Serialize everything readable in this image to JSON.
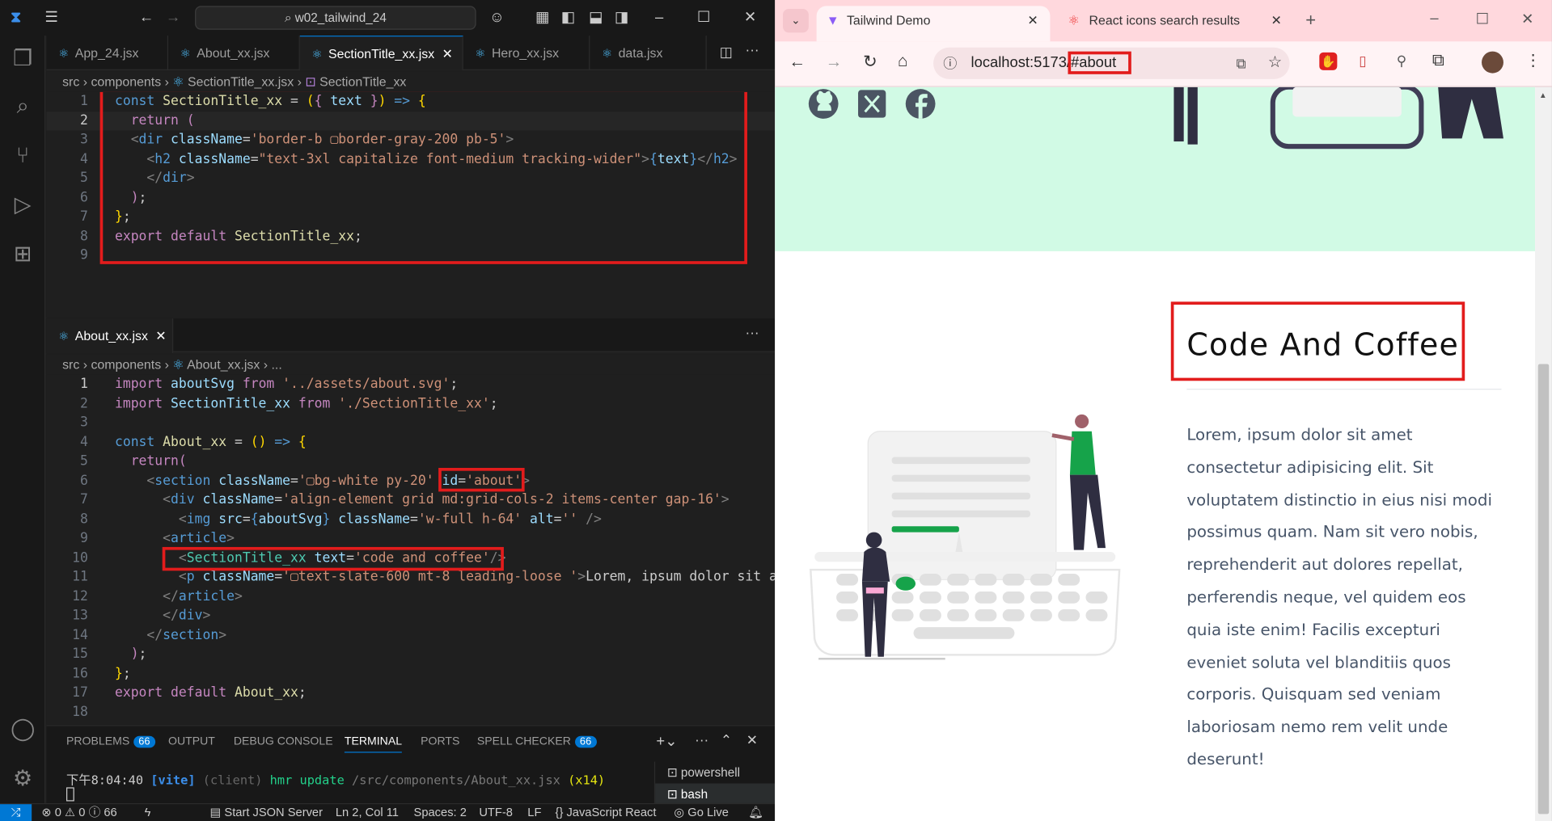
{
  "vscode": {
    "search_box": "w02_tailwind_24",
    "tabs": [
      {
        "label": "App_24.jsx"
      },
      {
        "label": "About_xx.jsx"
      },
      {
        "label": "SectionTitle_xx.jsx"
      },
      {
        "label": "Hero_xx.jsx"
      },
      {
        "label": "data.jsx"
      }
    ],
    "top_crumb": {
      "a": "src",
      "b": "components",
      "c": "SectionTitle_xx.jsx",
      "d": "SectionTitle_xx"
    },
    "bottom_tab": "About_xx.jsx",
    "bottom_crumb": {
      "a": "src",
      "b": "components",
      "c": "About_xx.jsx",
      "d": "..."
    },
    "panel_tabs": {
      "problems": "PROBLEMS",
      "problems_count": "66",
      "output": "OUTPUT",
      "debug": "DEBUG CONSOLE",
      "terminal": "TERMINAL",
      "ports": "PORTS",
      "spell": "SPELL CHECKER",
      "spell_count": "66"
    },
    "terminal": {
      "time": "下午8:04:40",
      "tag": "[vite]",
      "client": "(client)",
      "msg": "hmr update",
      "path": "/src/components/About_xx.jsx",
      "count": "(x14)"
    },
    "terminals": [
      "powershell",
      "bash"
    ],
    "status": {
      "errors": "0",
      "warnings": "0",
      "info": "66",
      "json": "Start JSON Server",
      "pos": "Ln 2, Col 11",
      "spaces": "Spaces: 2",
      "enc": "UTF-8",
      "eol": "LF",
      "lang": "{} JavaScript React",
      "live": "Go Live"
    }
  },
  "browser": {
    "tabs": [
      {
        "label": "Tailwind Demo"
      },
      {
        "label": "React icons search results"
      }
    ],
    "url_host": "localhost:5173/",
    "url_hash": "#about",
    "section_title": "Code And Coffee",
    "paragraph": "Lorem, ipsum dolor sit amet consectetur adipisicing elit. Sit voluptatem distinctio in eius nisi modi possimus quam. Nam sit vero nobis, reprehenderit aut dolores repellat, perferendis neque, vel quidem eos quia iste enim! Facilis excepturi eveniet soluta vel blanditiis quos corporis. Quisquam sed veniam laboriosam nemo rem velit unde deserunt!"
  },
  "colors": {
    "highlight": "#e21c1c",
    "accent": "#0078d4",
    "hero_bg": "#d1fae5",
    "illus_green": "#16a34a"
  }
}
